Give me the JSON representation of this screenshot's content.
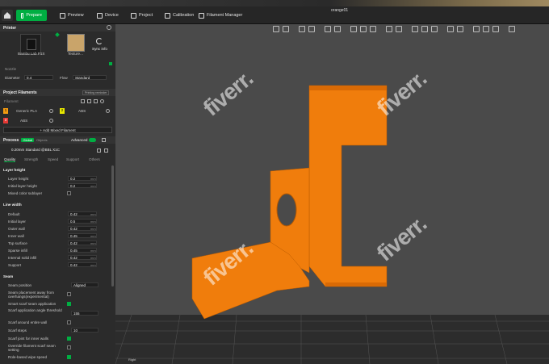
{
  "topbar": {
    "tabs": [
      {
        "label": "Prepare",
        "active": true
      },
      {
        "label": "Preview"
      },
      {
        "label": "Device"
      },
      {
        "label": "Project"
      },
      {
        "label": "Calibration"
      },
      {
        "label": "Filament Manager"
      }
    ],
    "title": "orange01"
  },
  "printer": {
    "section": "Printer",
    "printer_name": "Bambu Lab P1S",
    "plate_label": "Texture...",
    "sync_label": "Sync info",
    "nozzle_label": "Nozzle",
    "diameter_label": "Diameter",
    "diameter_value": "0.4",
    "flow_label": "Flow",
    "flow_value": "Standard"
  },
  "filaments": {
    "section": "Project Filaments",
    "filament_label": "Filament",
    "group_btn": "Printing reminder",
    "items": [
      {
        "num": "1",
        "name": "Generic PLA",
        "color": "#f39c12"
      },
      {
        "num": "2",
        "name": "ABS",
        "color": "#e8e800"
      },
      {
        "num": "3",
        "name": "ABS",
        "color": "#e53935"
      }
    ],
    "add_button": "+ Add Mixed Filament"
  },
  "process": {
    "section": "Process",
    "global": "Global",
    "objects": "Objects",
    "advanced": "Advanced",
    "preset": "0.20mm Standard @BBL X1C",
    "tabs": [
      "Quality",
      "Strength",
      "Speed",
      "Support",
      "Others"
    ]
  },
  "layer_height": {
    "header": "Layer height",
    "rows": [
      {
        "label": "Layer height",
        "value": "0.2",
        "unit": "mm"
      },
      {
        "label": "Initial layer height",
        "value": "0.2",
        "unit": "mm"
      }
    ],
    "mixed_color": "Mixed color sublayer"
  },
  "line_width": {
    "header": "Line width",
    "rows": [
      {
        "label": "Default",
        "value": "0.42",
        "unit": "mm"
      },
      {
        "label": "Initial layer",
        "value": "0.5",
        "unit": "mm"
      },
      {
        "label": "Outer wall",
        "value": "0.42",
        "unit": "mm"
      },
      {
        "label": "Inner wall",
        "value": "0.45",
        "unit": "mm"
      },
      {
        "label": "Top surface",
        "value": "0.42",
        "unit": "mm"
      },
      {
        "label": "Sparse infill",
        "value": "0.45",
        "unit": "mm"
      },
      {
        "label": "Internal solid infill",
        "value": "0.42",
        "unit": "mm"
      },
      {
        "label": "Support",
        "value": "0.42",
        "unit": "mm"
      }
    ]
  },
  "seam": {
    "header": "Seam",
    "position_label": "Seam position",
    "position_value": "Aligned",
    "away_label": "Seam placement away from overhangs(experimental)",
    "smart_label": "Smart scarf seam application",
    "angle_label": "Scarf application angle threshold",
    "angle_value": "155",
    "around_label": "Scarf around entire wall",
    "steps_label": "Scarf steps",
    "steps_value": "10",
    "inner_label": "Scarf joint for inner walls",
    "override_label": "Override filament scarf seam setting",
    "role_label": "Role-based wipe speed"
  },
  "viewport": {
    "watermark": "fiverr.",
    "right_label": "Right",
    "model_color": "#f07d0c"
  }
}
